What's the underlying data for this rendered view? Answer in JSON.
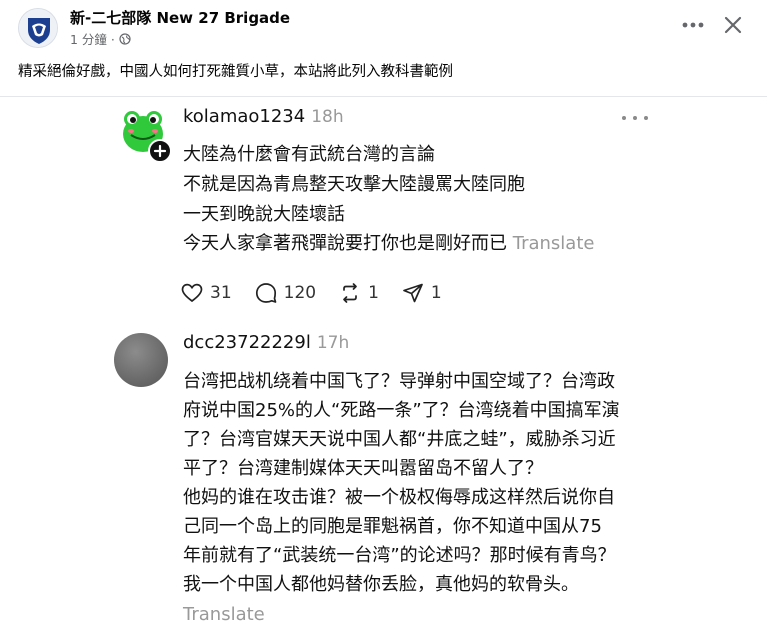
{
  "post": {
    "page_name": "新-二七部隊 New 27 Brigade",
    "time_text": "1 分鐘 ·",
    "caption": "精采絕倫好戲，中國人如何打死雜質小草，本站將此列入教科書範例"
  },
  "replies": [
    {
      "username": "kolamao1234",
      "time": "18h",
      "lines": [
        "大陸為什麼會有武統台灣的言論",
        "不就是因為青鳥整天攻擊大陸謾罵大陸同胞",
        "一天到晚說大陸壞話",
        "今天人家拿著飛彈說要打你也是剛好而已"
      ],
      "translate": "Translate",
      "likes": "31",
      "comments": "120",
      "reposts": "1",
      "shares": "1"
    },
    {
      "username": "dcc23722229l",
      "time": "17h",
      "lines": [
        "台湾把战机绕着中国飞了？导弹射中国空域了？台湾政",
        "府说中国25%的人“死路一条”了？台湾绕着中国搞军演",
        "了？台湾官媒天天说中国人都“井底之蛙”，威胁杀习近",
        "平了？台湾建制媒体天天叫嚣留岛不留人了？",
        "他妈的谁在攻击谁？被一个极权侮辱成这样然后说你自",
        "己同一个岛上的同胞是罪魁祸首，你不知道中国从75",
        "年前就有了“武装统一台湾”的论述吗？那时候有青鸟？",
        "我一个中国人都他妈替你丢脸，真他妈的软骨头。"
      ],
      "translate": "Translate"
    }
  ],
  "colors": {
    "frog_green": "#2fc93b",
    "gray_avatar": "#707070",
    "muted_text": "#999999",
    "brand_blue": "#1d3f8f"
  }
}
